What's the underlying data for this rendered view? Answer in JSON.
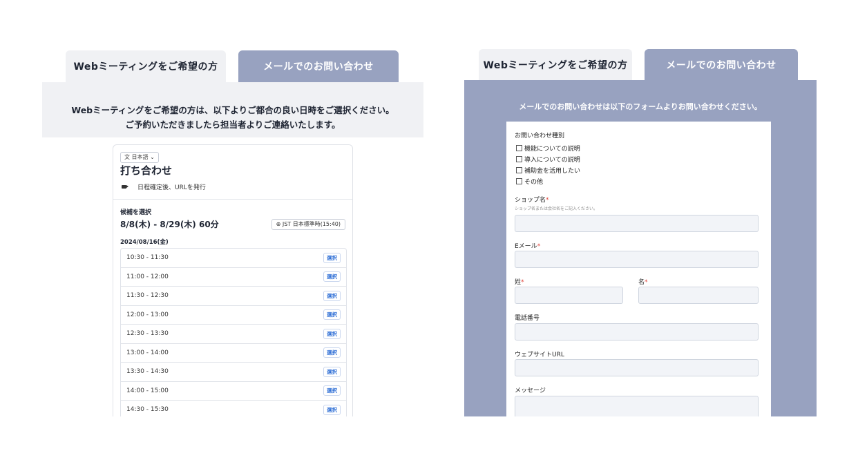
{
  "left": {
    "tabs": [
      {
        "label": "Webミーティングをご希望の方"
      },
      {
        "label": "メールでのお問い合わせ"
      }
    ],
    "intro_line1": "Webミーティングをご希望の方は、以下よりご都合の良い日時をご選択ください。",
    "intro_line2": "ご予約いただきましたら担当者よりご連絡いたします。",
    "card": {
      "language": "日本語 ⌄",
      "title": "打ち合わせ",
      "issue_text": "日程確定後、URLを発行",
      "candidate_label": "候補を選択",
      "date_range": "8/8(木) - 8/29(木) 60分",
      "timezone": "JST 日本標準時(15:40)",
      "date": "2024/08/16(金)",
      "select_label": "選択",
      "slots": [
        "10:30 - 11:30",
        "11:00 - 12:00",
        "11:30 - 12:30",
        "12:00 - 13:00",
        "12:30 - 13:30",
        "13:00 - 14:00",
        "13:30 - 14:30",
        "14:00 - 15:00",
        "14:30 - 15:30"
      ]
    }
  },
  "right": {
    "tabs": [
      {
        "label": "Webミーティングをご希望の方"
      },
      {
        "label": "メールでのお問い合わせ"
      }
    ],
    "intro": "メールでのお問い合わせは以下のフォームよりお問い合わせください。",
    "form": {
      "type_label": "お問い合わせ種別",
      "options": [
        "機能についての説明",
        "導入についての説明",
        "補助金を活用したい",
        "その他"
      ],
      "shop_label": "ショップ名",
      "shop_note": "ショップ名または会社名をご記入ください。",
      "email_label": "Eメール",
      "lastname_label": "姓",
      "firstname_label": "名",
      "phone_label": "電話番号",
      "website_label": "ウェブサイトURL",
      "message_label": "メッセージ",
      "required_mark": "*"
    }
  },
  "colors": {
    "accent": "#98a2c0",
    "light_tab": "#f0f1f4",
    "link": "#2f6fd6",
    "required": "#e0433a"
  }
}
